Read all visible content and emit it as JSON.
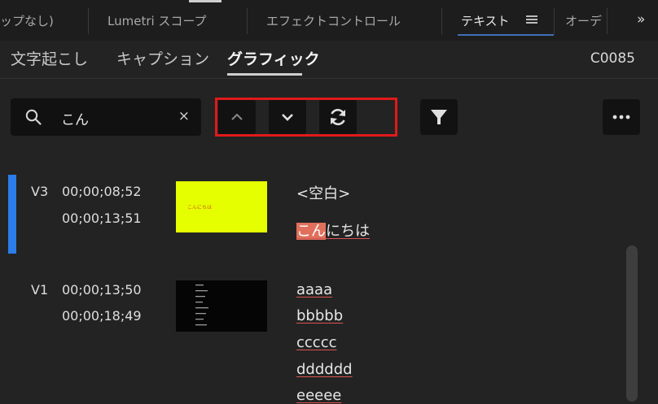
{
  "panel_tabs": {
    "tab1": "ップなし)",
    "tab2": "Lumetri スコープ",
    "tab3": "エフェクトコントロール",
    "tab4": "テキスト",
    "tab5": "オーデ",
    "more": "»"
  },
  "sub_tabs": {
    "transcribe": "文字起こし",
    "captions": "キャプション",
    "graphics": "グラフィック",
    "clip_name": "C0085"
  },
  "search": {
    "value": "こん",
    "clear": "×"
  },
  "rows": [
    {
      "track": "V3",
      "in": "00;00;08;52",
      "out": "00;00;13;51",
      "thumb_text": "こんにちは",
      "caption_empty": "<空白>",
      "caption_match": "こん",
      "caption_rest": "にちは"
    },
    {
      "track": "V1",
      "in": "00;00;13;50",
      "out": "00;00;18;49",
      "lines": [
        "aaaa",
        "bbbbb",
        "ccccc",
        "dddddd",
        "eeeee"
      ]
    }
  ],
  "colors": {
    "accent_blue": "#2b7de9",
    "highlight_red": "#e11a1a",
    "match_bg": "#e0705c",
    "thumb_yellow": "#e6ff00"
  }
}
